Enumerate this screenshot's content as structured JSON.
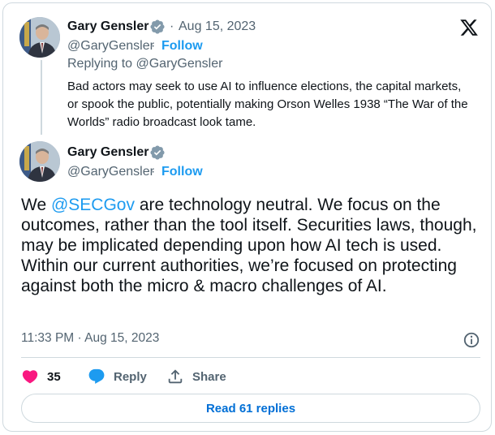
{
  "colors": {
    "accent": "#1d9bf0",
    "like_red": "#f91880",
    "secondary_text": "#536471",
    "border": "#cfd9de",
    "verified_badge": "#829aab"
  },
  "parent_tweet": {
    "author_name": "Gary Gensler",
    "separator": "·",
    "date": "Aug 15, 2023",
    "handle": "@GaryGensler",
    "follow_label": "Follow",
    "replying_to": "Replying to @GaryGensler",
    "text": "Bad actors may seek to use AI to influence elections, the capital markets, or spook the public, potentially making Orson Welles 1938 “The War of the Worlds” radio broadcast look tame."
  },
  "main_tweet": {
    "author_name": "Gary Gensler",
    "handle": "@GaryGensler",
    "follow_label": "Follow",
    "text_before_mention": "We ",
    "mention": "@SECGov",
    "text_after_mention": " are technology neutral. We focus on the outcomes, rather than the tool itself. Securities laws, though, may be implicated depending upon how AI tech is used. Within our current authorities, we’re focused on protecting against both the micro & macro challenges of AI.",
    "timestamp": "11:33 PM · Aug 15, 2023"
  },
  "actions": {
    "like_count": "35",
    "reply_label": "Reply",
    "share_label": "Share"
  },
  "read_replies_label": "Read 61 replies",
  "icons": [
    "verified-badge-icon",
    "x-logo-icon",
    "info-icon",
    "heart-icon",
    "reply-bubble-icon",
    "share-icon"
  ]
}
